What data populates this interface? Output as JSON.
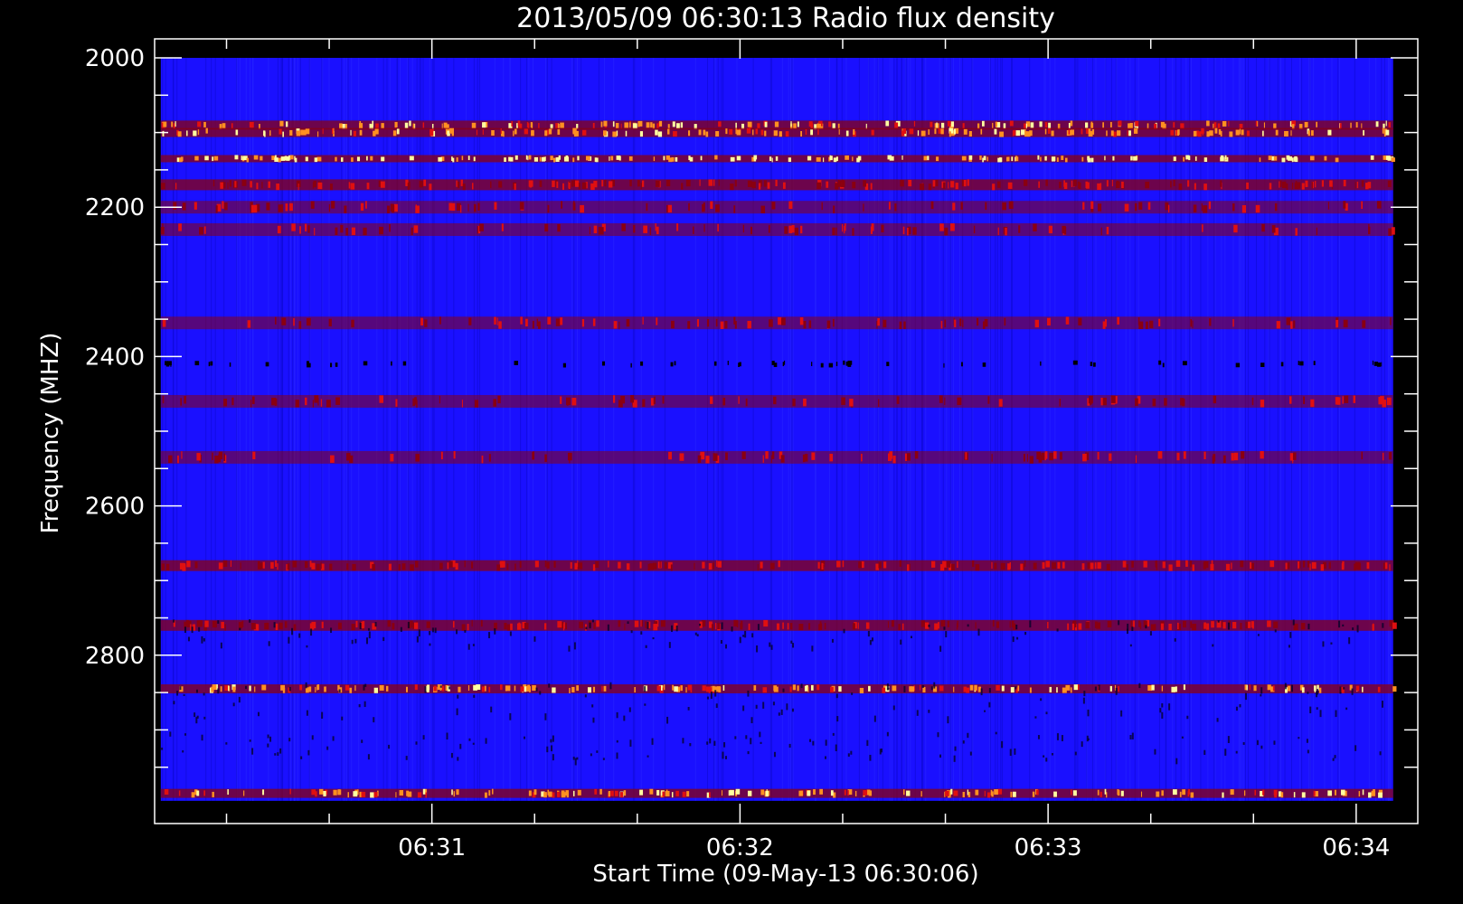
{
  "chart_data": {
    "type": "heatmap",
    "title": "2013/05/09 06:30:13 Radio flux density",
    "xlabel": "Start Time (09-May-13 06:30:06)",
    "ylabel": "Frequency (MHZ)",
    "xlim": [
      "06:30:06",
      "06:34:12"
    ],
    "ylim": [
      2000,
      3000
    ],
    "y_reversed": true,
    "x_ticks": [
      "06:31",
      "06:32",
      "06:33",
      "06:34"
    ],
    "x_tick_minutes": [
      1,
      2,
      3,
      4
    ],
    "y_ticks": [
      2000,
      2200,
      2400,
      2600,
      2800
    ],
    "data_extent": {
      "t_start_min": 0.12,
      "t_end_min": 4.12,
      "f_start": 2000,
      "f_end": 2995
    },
    "bands": [
      {
        "f": 2090,
        "level": "high"
      },
      {
        "f": 2100,
        "level": "high"
      },
      {
        "f": 2135,
        "level": "very-high"
      },
      {
        "f": 2170,
        "level": "medium"
      },
      {
        "f": 2200,
        "level": "low"
      },
      {
        "f": 2230,
        "level": "low"
      },
      {
        "f": 2355,
        "level": "low"
      },
      {
        "f": 2410,
        "level": "dip"
      },
      {
        "f": 2460,
        "level": "low"
      },
      {
        "f": 2535,
        "level": "low"
      },
      {
        "f": 2680,
        "level": "medium"
      },
      {
        "f": 2760,
        "level": "medium"
      },
      {
        "f": 2845,
        "level": "high"
      },
      {
        "f": 2985,
        "level": "high"
      }
    ],
    "colormap": {
      "background": "#1a10ff",
      "low": "#8a0010",
      "medium": "#e01010",
      "high": "#ff9020",
      "very-high": "#ffffa0",
      "dip": "#000000"
    }
  }
}
